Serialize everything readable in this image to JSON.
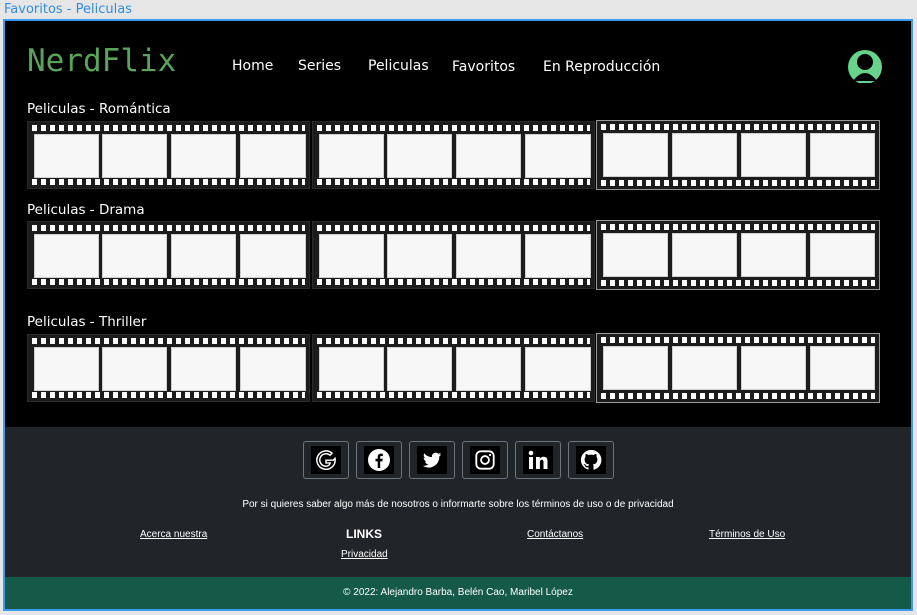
{
  "window": {
    "title": "Favoritos - Peliculas"
  },
  "header": {
    "logo": "NerdFlix",
    "nav": [
      "Home",
      "Series",
      "Peliculas",
      "Favoritos",
      "En Reproducción"
    ]
  },
  "categories": [
    {
      "title": "Peliculas - Romántica"
    },
    {
      "title": "Peliculas - Drama"
    },
    {
      "title": "Peliculas - Thriller"
    }
  ],
  "footer": {
    "socials": [
      "google-icon",
      "facebook-icon",
      "twitter-icon",
      "instagram-icon",
      "linkedin-icon",
      "github-icon"
    ],
    "text": "Por si quieres saber algo más de nosotros o informarte sobre los términos de uso o de privacidad",
    "links": {
      "about": "Acerca nuestra",
      "title": "LINKS",
      "contact": "Contáctanos",
      "terms": "Términos de Uso",
      "privacy": "Privacidad"
    },
    "copyright": "© 2022: Alejandro Barba, Belén Cao, Maribel López"
  },
  "colors": {
    "accent": "#3c9bf0",
    "logo": "#5aa35a",
    "avatar": "#67d38b",
    "footer_bg": "#212529",
    "copyright_bg": "#155a48"
  }
}
